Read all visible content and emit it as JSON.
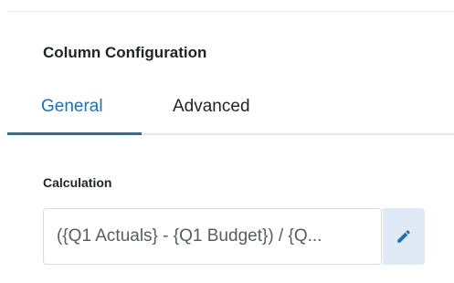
{
  "panel": {
    "title": "Column Configuration"
  },
  "tabs": [
    {
      "label": "General",
      "active": true
    },
    {
      "label": "Advanced",
      "active": false
    }
  ],
  "calculation": {
    "label": "Calculation",
    "value": "({Q1 Actuals} - {Q1 Budget}) / {Q...",
    "edit_icon": "pencil-icon"
  },
  "colors": {
    "accent": "#1f6fb5",
    "edit_button_bg": "#dfeaf6",
    "text_primary": "#1f2327"
  }
}
